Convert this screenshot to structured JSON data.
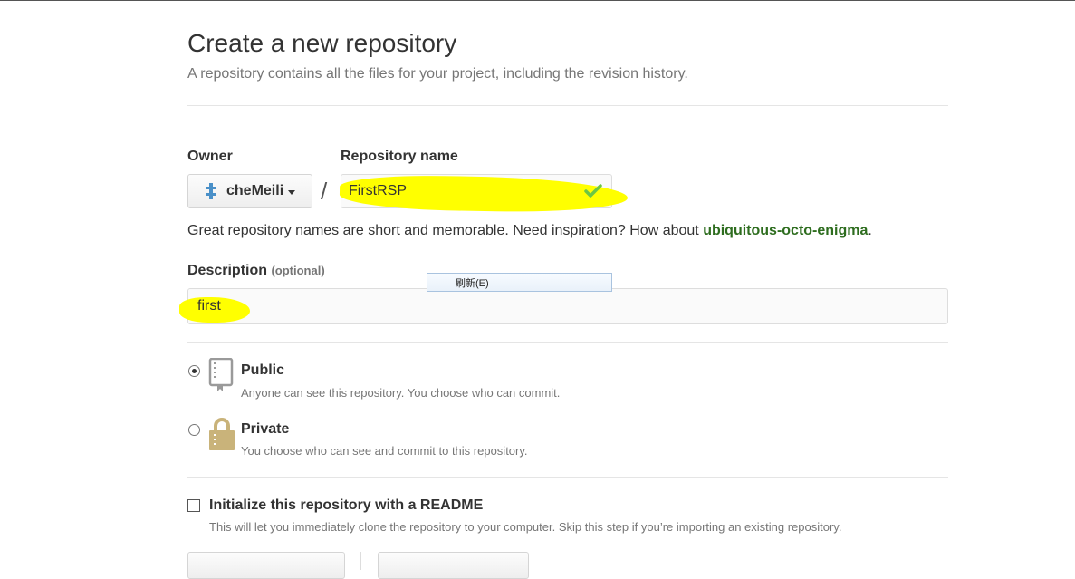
{
  "header": {
    "title": "Create a new repository",
    "subtitle": "A repository contains all the files for your project, including the revision history."
  },
  "owner": {
    "label": "Owner",
    "value": "cheMeili"
  },
  "repository": {
    "label": "Repository name",
    "separator": "/",
    "value": "FirstRSP"
  },
  "hint": {
    "text": "Great repository names are short and memorable. Need inspiration? How about ",
    "suggestion": "ubiquitous-octo-enigma",
    "suffix": "."
  },
  "description": {
    "label": "Description",
    "optional": "(optional)",
    "value": "first"
  },
  "context_menu": {
    "item": "刷新(E)"
  },
  "visibility": {
    "public": {
      "label": "Public",
      "description": "Anyone can see this repository. You choose who can commit.",
      "selected": true
    },
    "private": {
      "label": "Private",
      "description": "You choose who can see and commit to this repository.",
      "selected": false
    }
  },
  "readme": {
    "label": "Initialize this repository with a README",
    "description": "This will let you immediately clone the repository to your computer. Skip this step if you’re importing an existing repository.",
    "checked": false
  },
  "colors": {
    "highlight": "#ffff00",
    "suggestion": "#2e6d1f",
    "check": "#6cc644",
    "lock": "#c9b37a"
  },
  "icons": {
    "owner": "repo-owner-icon",
    "valid": "check-icon",
    "public": "repo-book-icon",
    "private": "lock-icon"
  }
}
